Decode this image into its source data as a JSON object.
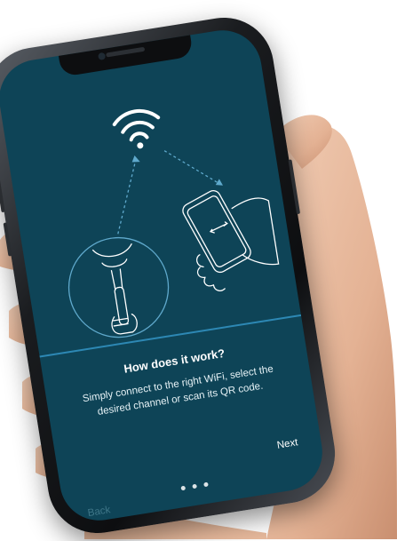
{
  "onboarding": {
    "title": "How does it work?",
    "description": "Simply connect to the right WiFi, select the desired channel or scan its QR code.",
    "next_label": "Next",
    "back_label": "Back",
    "page_count": 3,
    "current_page": 3
  },
  "colors": {
    "screen_bg": "#0e4457",
    "accent": "#2d88b4",
    "text": "#ffffff"
  },
  "icons": [
    "wifi-icon",
    "microphone-user-illustration",
    "phone-in-hand-illustration"
  ]
}
